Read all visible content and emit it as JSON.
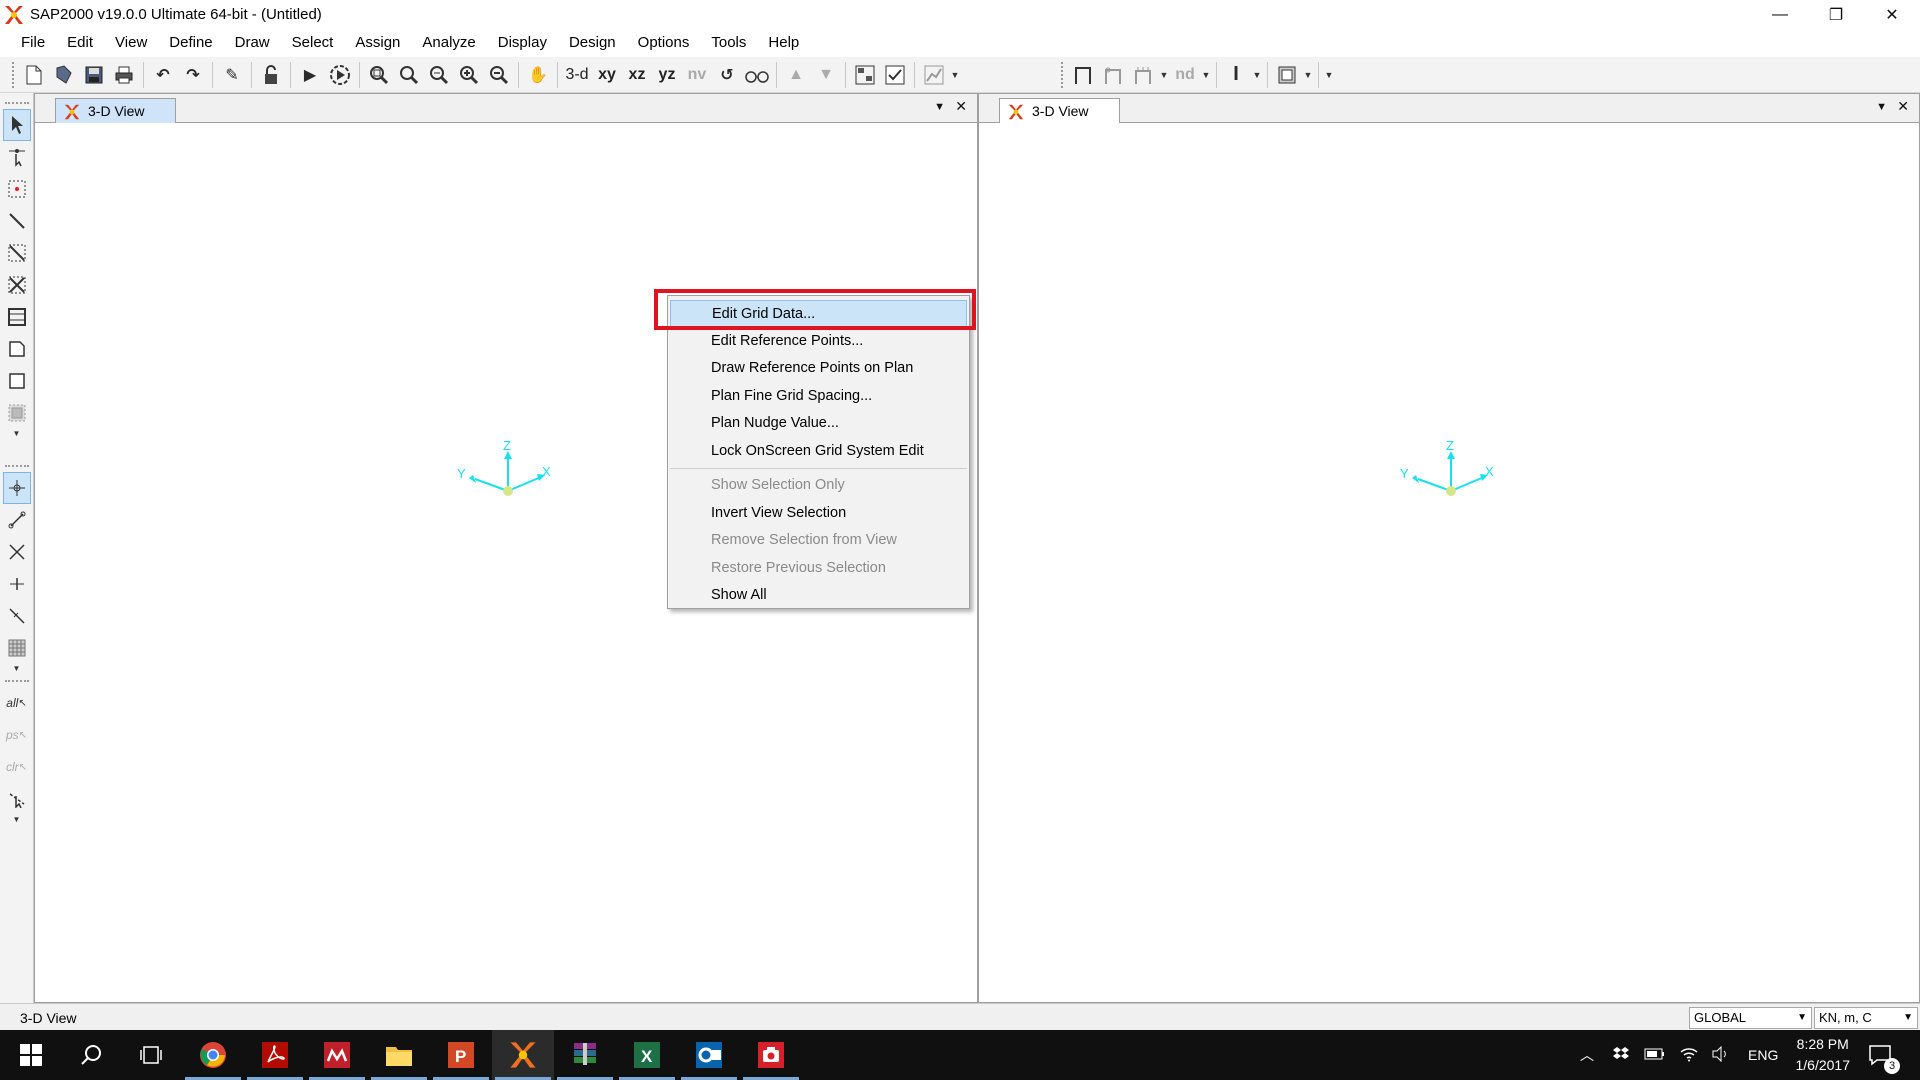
{
  "window": {
    "title": "SAP2000 v19.0.0 Ultimate 64-bit - (Untitled)",
    "minimize": "—",
    "restore": "❐",
    "close": "✕"
  },
  "menu": [
    "File",
    "Edit",
    "View",
    "Define",
    "Draw",
    "Select",
    "Assign",
    "Analyze",
    "Display",
    "Design",
    "Options",
    "Tools",
    "Help"
  ],
  "toolbar": {
    "view_3d": "3-d",
    "view_xy": "xy",
    "view_xz": "xz",
    "view_yz": "yz",
    "view_nv": "nv",
    "nd": "nd"
  },
  "left_toolbar": {
    "all": "all",
    "ps": "ps",
    "clr": "clr"
  },
  "panels": {
    "left": {
      "tab": "3-D View",
      "active": true
    },
    "right": {
      "tab": "3-D View",
      "active": false
    },
    "axes": {
      "x": "X",
      "y": "Y",
      "z": "Z"
    }
  },
  "context_menu": {
    "items": [
      {
        "label": "Edit Grid Data...",
        "highlighted": true,
        "enabled": true
      },
      {
        "label": "Edit Reference Points...",
        "enabled": true
      },
      {
        "label": "Draw Reference Points on Plan",
        "enabled": true
      },
      {
        "label": "Plan Fine Grid Spacing...",
        "enabled": true
      },
      {
        "label": "Plan Nudge Value...",
        "enabled": true
      },
      {
        "label": "Lock OnScreen Grid System Edit",
        "enabled": true
      },
      {
        "label": "Show Selection Only",
        "enabled": false
      },
      {
        "label": "Invert View Selection",
        "enabled": true
      },
      {
        "label": "Remove Selection from View",
        "enabled": false
      },
      {
        "label": "Restore Previous Selection",
        "enabled": false
      },
      {
        "label": "Show All",
        "enabled": true
      }
    ]
  },
  "statusbar": {
    "text": "3-D View",
    "coord_system": "GLOBAL",
    "units": "KN, m, C"
  },
  "taskbar": {
    "language": "ENG",
    "time": "8:28 PM",
    "date": "1/6/2017",
    "notifications": "3"
  },
  "colors": {
    "accent_highlight": "#cce4f7",
    "annotation_red": "#e0141e",
    "axes_cyan": "#19e0ef",
    "taskbar": "#101010"
  }
}
